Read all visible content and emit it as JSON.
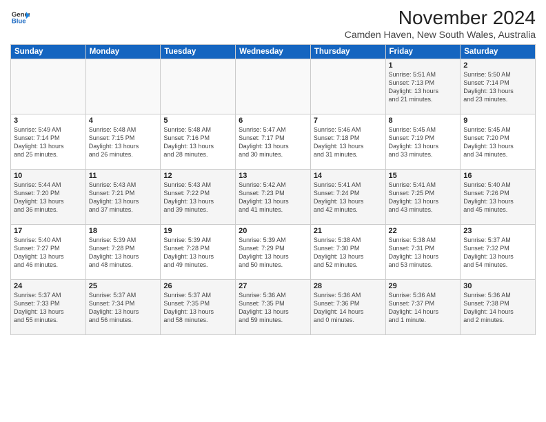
{
  "header": {
    "logo_line1": "General",
    "logo_line2": "Blue",
    "month_title": "November 2024",
    "location": "Camden Haven, New South Wales, Australia"
  },
  "weekdays": [
    "Sunday",
    "Monday",
    "Tuesday",
    "Wednesday",
    "Thursday",
    "Friday",
    "Saturday"
  ],
  "weeks": [
    [
      {
        "day": "",
        "info": ""
      },
      {
        "day": "",
        "info": ""
      },
      {
        "day": "",
        "info": ""
      },
      {
        "day": "",
        "info": ""
      },
      {
        "day": "",
        "info": ""
      },
      {
        "day": "1",
        "info": "Sunrise: 5:51 AM\nSunset: 7:13 PM\nDaylight: 13 hours\nand 21 minutes."
      },
      {
        "day": "2",
        "info": "Sunrise: 5:50 AM\nSunset: 7:14 PM\nDaylight: 13 hours\nand 23 minutes."
      }
    ],
    [
      {
        "day": "3",
        "info": "Sunrise: 5:49 AM\nSunset: 7:14 PM\nDaylight: 13 hours\nand 25 minutes."
      },
      {
        "day": "4",
        "info": "Sunrise: 5:48 AM\nSunset: 7:15 PM\nDaylight: 13 hours\nand 26 minutes."
      },
      {
        "day": "5",
        "info": "Sunrise: 5:48 AM\nSunset: 7:16 PM\nDaylight: 13 hours\nand 28 minutes."
      },
      {
        "day": "6",
        "info": "Sunrise: 5:47 AM\nSunset: 7:17 PM\nDaylight: 13 hours\nand 30 minutes."
      },
      {
        "day": "7",
        "info": "Sunrise: 5:46 AM\nSunset: 7:18 PM\nDaylight: 13 hours\nand 31 minutes."
      },
      {
        "day": "8",
        "info": "Sunrise: 5:45 AM\nSunset: 7:19 PM\nDaylight: 13 hours\nand 33 minutes."
      },
      {
        "day": "9",
        "info": "Sunrise: 5:45 AM\nSunset: 7:20 PM\nDaylight: 13 hours\nand 34 minutes."
      }
    ],
    [
      {
        "day": "10",
        "info": "Sunrise: 5:44 AM\nSunset: 7:20 PM\nDaylight: 13 hours\nand 36 minutes."
      },
      {
        "day": "11",
        "info": "Sunrise: 5:43 AM\nSunset: 7:21 PM\nDaylight: 13 hours\nand 37 minutes."
      },
      {
        "day": "12",
        "info": "Sunrise: 5:43 AM\nSunset: 7:22 PM\nDaylight: 13 hours\nand 39 minutes."
      },
      {
        "day": "13",
        "info": "Sunrise: 5:42 AM\nSunset: 7:23 PM\nDaylight: 13 hours\nand 41 minutes."
      },
      {
        "day": "14",
        "info": "Sunrise: 5:41 AM\nSunset: 7:24 PM\nDaylight: 13 hours\nand 42 minutes."
      },
      {
        "day": "15",
        "info": "Sunrise: 5:41 AM\nSunset: 7:25 PM\nDaylight: 13 hours\nand 43 minutes."
      },
      {
        "day": "16",
        "info": "Sunrise: 5:40 AM\nSunset: 7:26 PM\nDaylight: 13 hours\nand 45 minutes."
      }
    ],
    [
      {
        "day": "17",
        "info": "Sunrise: 5:40 AM\nSunset: 7:27 PM\nDaylight: 13 hours\nand 46 minutes."
      },
      {
        "day": "18",
        "info": "Sunrise: 5:39 AM\nSunset: 7:28 PM\nDaylight: 13 hours\nand 48 minutes."
      },
      {
        "day": "19",
        "info": "Sunrise: 5:39 AM\nSunset: 7:28 PM\nDaylight: 13 hours\nand 49 minutes."
      },
      {
        "day": "20",
        "info": "Sunrise: 5:39 AM\nSunset: 7:29 PM\nDaylight: 13 hours\nand 50 minutes."
      },
      {
        "day": "21",
        "info": "Sunrise: 5:38 AM\nSunset: 7:30 PM\nDaylight: 13 hours\nand 52 minutes."
      },
      {
        "day": "22",
        "info": "Sunrise: 5:38 AM\nSunset: 7:31 PM\nDaylight: 13 hours\nand 53 minutes."
      },
      {
        "day": "23",
        "info": "Sunrise: 5:37 AM\nSunset: 7:32 PM\nDaylight: 13 hours\nand 54 minutes."
      }
    ],
    [
      {
        "day": "24",
        "info": "Sunrise: 5:37 AM\nSunset: 7:33 PM\nDaylight: 13 hours\nand 55 minutes."
      },
      {
        "day": "25",
        "info": "Sunrise: 5:37 AM\nSunset: 7:34 PM\nDaylight: 13 hours\nand 56 minutes."
      },
      {
        "day": "26",
        "info": "Sunrise: 5:37 AM\nSunset: 7:35 PM\nDaylight: 13 hours\nand 58 minutes."
      },
      {
        "day": "27",
        "info": "Sunrise: 5:36 AM\nSunset: 7:35 PM\nDaylight: 13 hours\nand 59 minutes."
      },
      {
        "day": "28",
        "info": "Sunrise: 5:36 AM\nSunset: 7:36 PM\nDaylight: 14 hours\nand 0 minutes."
      },
      {
        "day": "29",
        "info": "Sunrise: 5:36 AM\nSunset: 7:37 PM\nDaylight: 14 hours\nand 1 minute."
      },
      {
        "day": "30",
        "info": "Sunrise: 5:36 AM\nSunset: 7:38 PM\nDaylight: 14 hours\nand 2 minutes."
      }
    ]
  ]
}
